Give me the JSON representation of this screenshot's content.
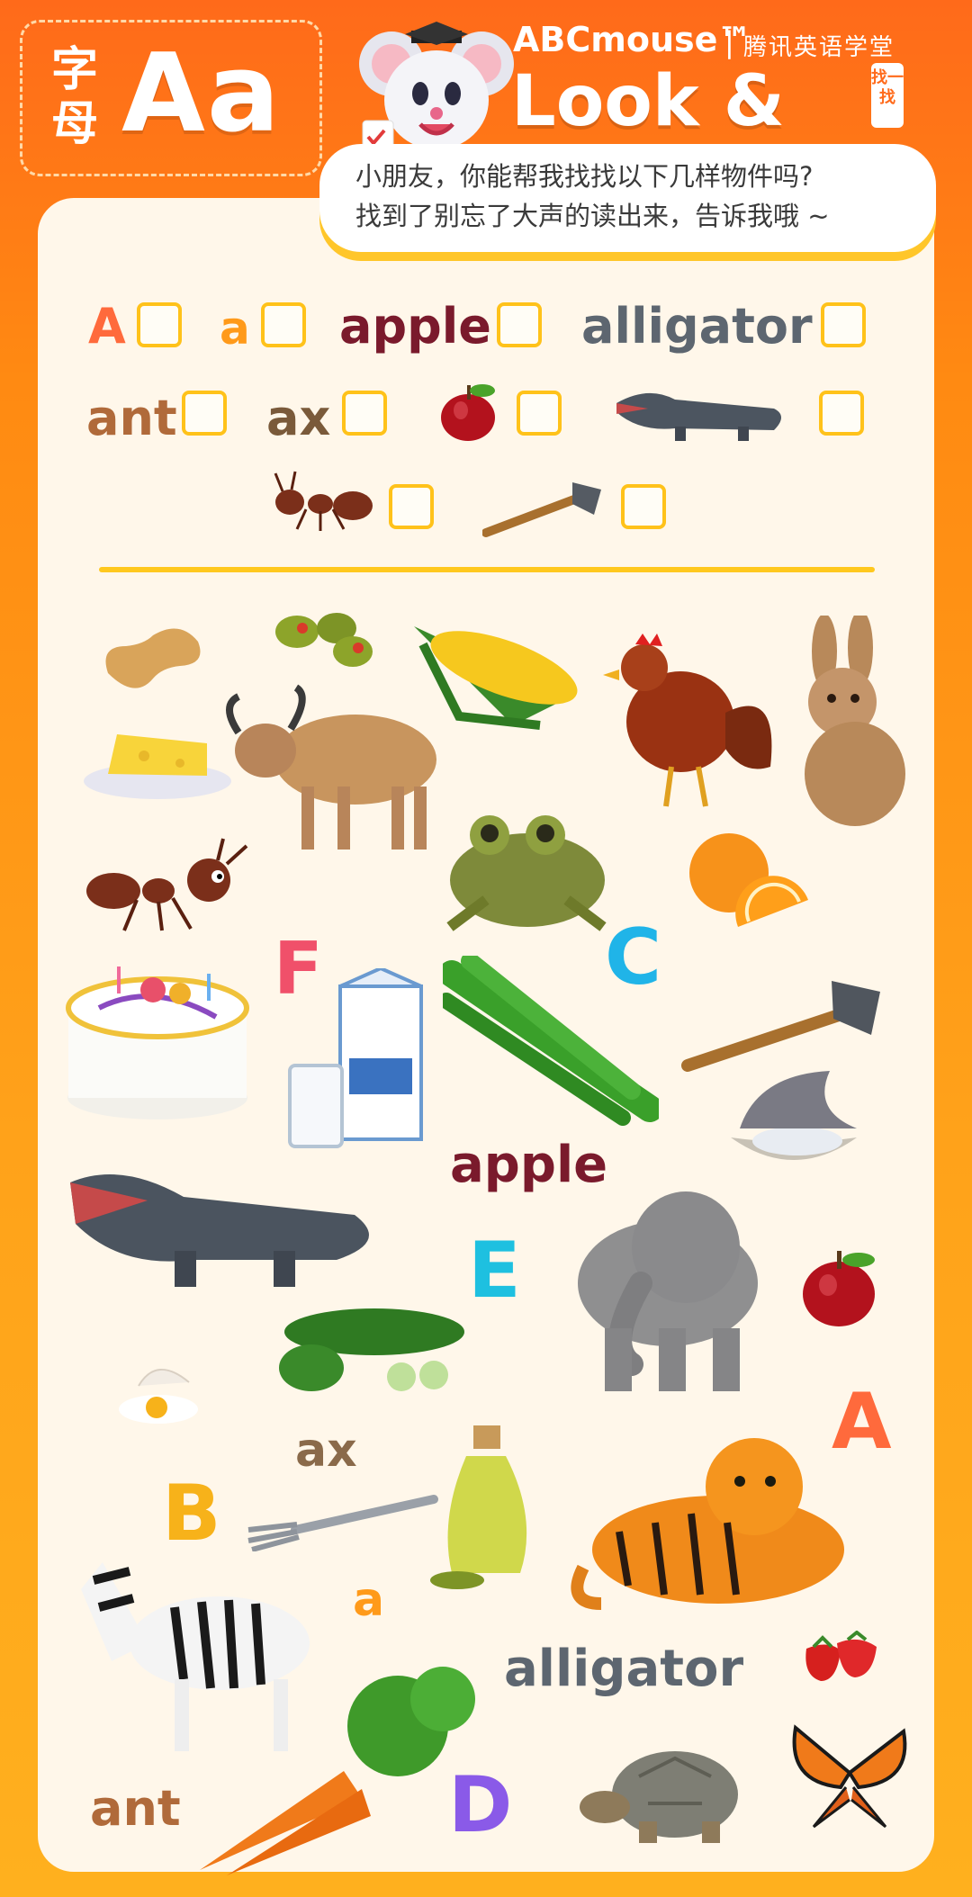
{
  "header": {
    "badge_zh": "字母",
    "badge_letters": "Aa",
    "brand": "ABCmouse™",
    "brand_zh": "腾讯英语学堂",
    "title": "Look & Find",
    "tag": "找一找",
    "bubble_line1": "小朋友，你能帮我找找以下几样物件吗?",
    "bubble_line2": "找到了别忘了大声的读出来，告诉我哦 ~"
  },
  "checklist": {
    "row1": [
      "A",
      "a",
      "apple",
      "alligator"
    ],
    "row2": [
      "ant",
      "ax"
    ]
  },
  "scene_words": {
    "f": "F",
    "c": "C",
    "apple": "apple",
    "e": "E",
    "a_upper": "A",
    "ax": "ax",
    "b": "B",
    "a_lower": "a",
    "alligator": "alligator",
    "ant": "ant",
    "d": "D"
  },
  "colors": {
    "accent": "#ff6a1a",
    "checkbox": "#ffc21a",
    "card": "#fff7ea"
  }
}
